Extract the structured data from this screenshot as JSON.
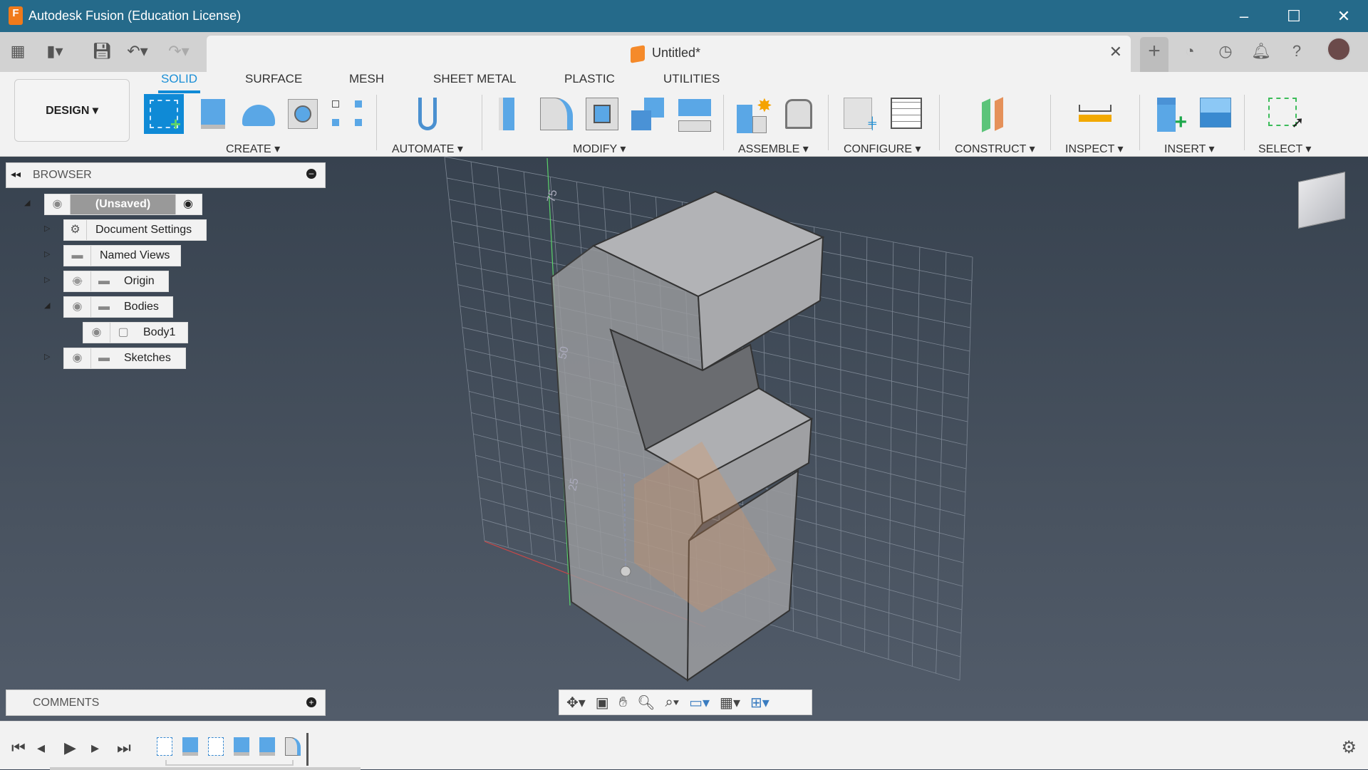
{
  "window": {
    "title": "Autodesk Fusion (Education License)",
    "logo_letter": "F",
    "minimize": "–",
    "maximize": "☐",
    "close": "✕"
  },
  "quick_access": {
    "icons": [
      "apps-grid-icon",
      "file-icon",
      "save-icon",
      "undo-icon",
      "redo-icon"
    ]
  },
  "document_tab": {
    "name": "Untitled*",
    "close": "✕"
  },
  "top_right": {
    "new_tab": "+",
    "icons": [
      "extensions-icon",
      "job-status-icon",
      "notifications-icon",
      "help-icon",
      "user-avatar"
    ]
  },
  "ribbon": {
    "workspace": "DESIGN ▾",
    "tabs": [
      {
        "label": "SOLID",
        "active": true
      },
      {
        "label": "SURFACE"
      },
      {
        "label": "MESH"
      },
      {
        "label": "SHEET METAL"
      },
      {
        "label": "PLASTIC"
      },
      {
        "label": "UTILITIES"
      }
    ],
    "groups": [
      {
        "label": "CREATE ▾"
      },
      {
        "label": "AUTOMATE ▾"
      },
      {
        "label": "MODIFY ▾"
      },
      {
        "label": "ASSEMBLE ▾"
      },
      {
        "label": "CONFIGURE ▾"
      },
      {
        "label": "CONSTRUCT ▾"
      },
      {
        "label": "INSPECT ▾"
      },
      {
        "label": "INSERT ▾"
      },
      {
        "label": "SELECT ▾"
      }
    ]
  },
  "browser": {
    "title": "BROWSER",
    "root": "(Unsaved)",
    "items": [
      {
        "label": "Document Settings"
      },
      {
        "label": "Named Views"
      },
      {
        "label": "Origin",
        "visible": false
      },
      {
        "label": "Bodies",
        "expanded": true
      },
      {
        "label": "Body1"
      },
      {
        "label": "Sketches"
      }
    ]
  },
  "comments": {
    "title": "COMMENTS"
  },
  "viewport": {
    "grid_labels": [
      "75",
      "50",
      "25"
    ],
    "accent": "#1b8fd6"
  },
  "nav_toolbar": {
    "icons": [
      "orbit-icon",
      "look-at-icon",
      "pan-icon",
      "zoom-icon",
      "fit-icon",
      "display-settings-icon",
      "grid-settings-icon",
      "viewports-icon"
    ]
  },
  "timeline": {
    "controls": [
      "first",
      "previous",
      "play",
      "next",
      "last"
    ],
    "features": [
      "sketch",
      "extrude",
      "sketch",
      "extrude",
      "extrude",
      "fillet"
    ]
  }
}
